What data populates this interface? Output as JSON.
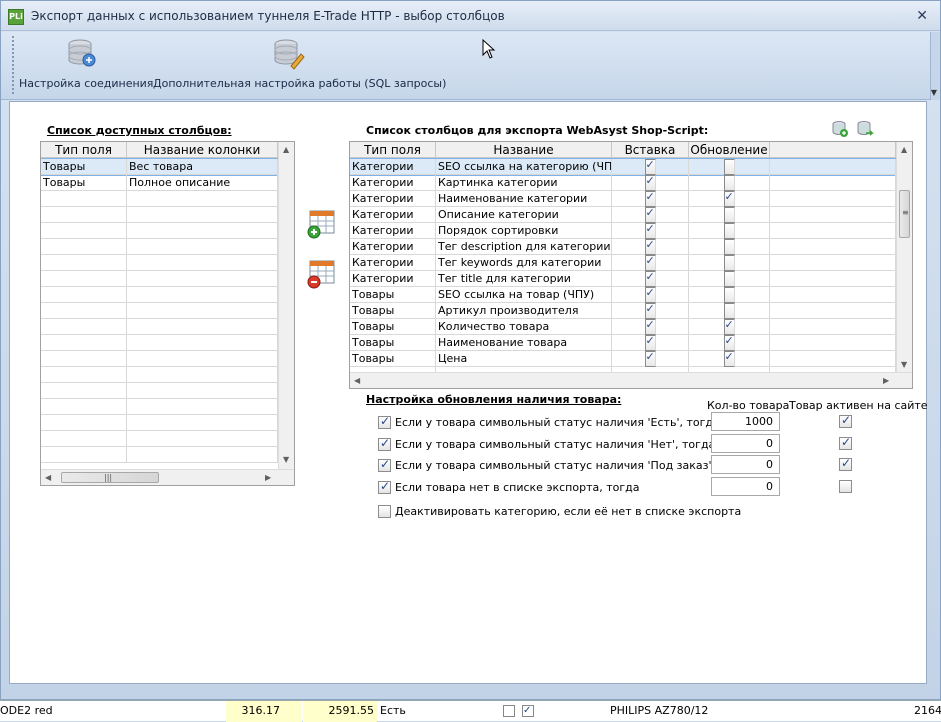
{
  "window": {
    "title": "Экспорт данных с использованием туннеля E-Trade HTTP - выбор столбцов",
    "app_icon_text": "PLi"
  },
  "toolbar": {
    "connection_label": "Настройка соединения",
    "sql_label": "Дополнительная настройка работы (SQL запросы)"
  },
  "available": {
    "heading": "Список доступных столбцов:",
    "columns": [
      "Тип поля",
      "Название колонки"
    ],
    "rows": [
      [
        "Товары",
        "Вес товара"
      ],
      [
        "Товары",
        "Полное описание"
      ]
    ]
  },
  "export": {
    "heading": "Список столбцов для экспорта WebAsyst Shop-Script:",
    "columns": [
      "Тип поля",
      "Название",
      "Вставка",
      "Обновление"
    ],
    "rows": [
      {
        "type": "Категории",
        "name": "SEO ссылка на категорию (ЧПУ)",
        "insert": true,
        "update": false
      },
      {
        "type": "Категории",
        "name": "Картинка категории",
        "insert": true,
        "update": false
      },
      {
        "type": "Категории",
        "name": "Наименование категории",
        "insert": true,
        "update": true
      },
      {
        "type": "Категории",
        "name": "Описание категории",
        "insert": true,
        "update": false
      },
      {
        "type": "Категории",
        "name": "Порядок сортировки",
        "insert": true,
        "update": false
      },
      {
        "type": "Категории",
        "name": "Тег description для категории",
        "insert": true,
        "update": false
      },
      {
        "type": "Категории",
        "name": "Тег keywords для категории",
        "insert": true,
        "update": false
      },
      {
        "type": "Категории",
        "name": "Тег title для категории",
        "insert": true,
        "update": false
      },
      {
        "type": "Товары",
        "name": "SEO ссылка на товар (ЧПУ)",
        "insert": true,
        "update": false
      },
      {
        "type": "Товары",
        "name": "Артикул производителя",
        "insert": true,
        "update": false
      },
      {
        "type": "Товары",
        "name": "Количество товара",
        "insert": true,
        "update": true
      },
      {
        "type": "Товары",
        "name": "Наименование товара",
        "insert": true,
        "update": true
      },
      {
        "type": "Товары",
        "name": "Цена",
        "insert": true,
        "update": true
      }
    ]
  },
  "stock": {
    "heading": "Настройка обновления наличия товара:",
    "qty_header": "Кол-во товара",
    "active_header": "Товар активен на сайте",
    "rows": [
      {
        "label": "Если у товара символьный статус наличия 'Есть', тогда",
        "checked": true,
        "qty": "1000",
        "active": true
      },
      {
        "label": "Если у товара символьный статус наличия 'Нет', тогда",
        "checked": true,
        "qty": "0",
        "active": true
      },
      {
        "label": "Если у товара символьный статус наличия 'Под заказ', тогда",
        "checked": true,
        "qty": "0",
        "active": true
      },
      {
        "label": "Если товара нет в списке экспорта, тогда",
        "checked": true,
        "qty": "0",
        "active": false
      }
    ],
    "deactivate_label": "Деактивировать категорию, если её нет в списке экспорта",
    "deactivate_checked": false
  },
  "background": {
    "cells": [
      "ODE2 red",
      "316.17",
      "2591.55",
      "Есть",
      "PHILIPS AZ780/12",
      "2164"
    ]
  },
  "colors": {
    "selected_row": "#dceaf8",
    "window_bg": "#c9d7e8",
    "highlight_cell": "#ffffcc"
  }
}
